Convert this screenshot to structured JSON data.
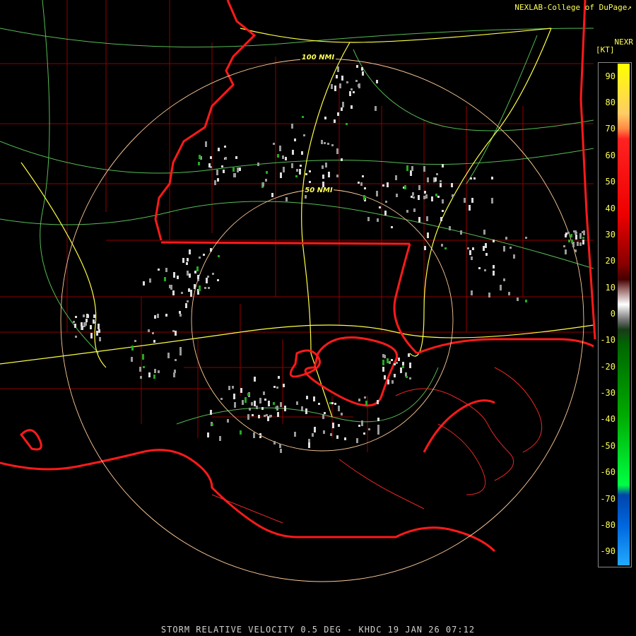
{
  "credit": "NEXLAB-College of DuPage",
  "credit_icon": "external-link-icon",
  "product_code": "NEXR",
  "unit_label": "[KT]",
  "caption": "STORM RELATIVE VELOCITY 0.5 DEG - KHDC 19 JAN 26 07:12",
  "range_rings": [
    {
      "label": "100 NMI",
      "range_nmi": 100
    },
    {
      "label": "50 NMI",
      "range_nmi": 50
    }
  ],
  "colorbar": {
    "ticks": [
      "90",
      "80",
      "70",
      "60",
      "50",
      "40",
      "30",
      "20",
      "10",
      "0",
      "-10",
      "-20",
      "-30",
      "-40",
      "-50",
      "-60",
      "-70",
      "-80",
      "-90"
    ],
    "min": -95,
    "max": 95
  },
  "colors": {
    "state_borders": "#ff0000",
    "county_borders": "#a00000",
    "highways": "#ffff44",
    "roads": "#66dd66",
    "range_rings": "#ffcc99",
    "text": "#ffff55"
  }
}
